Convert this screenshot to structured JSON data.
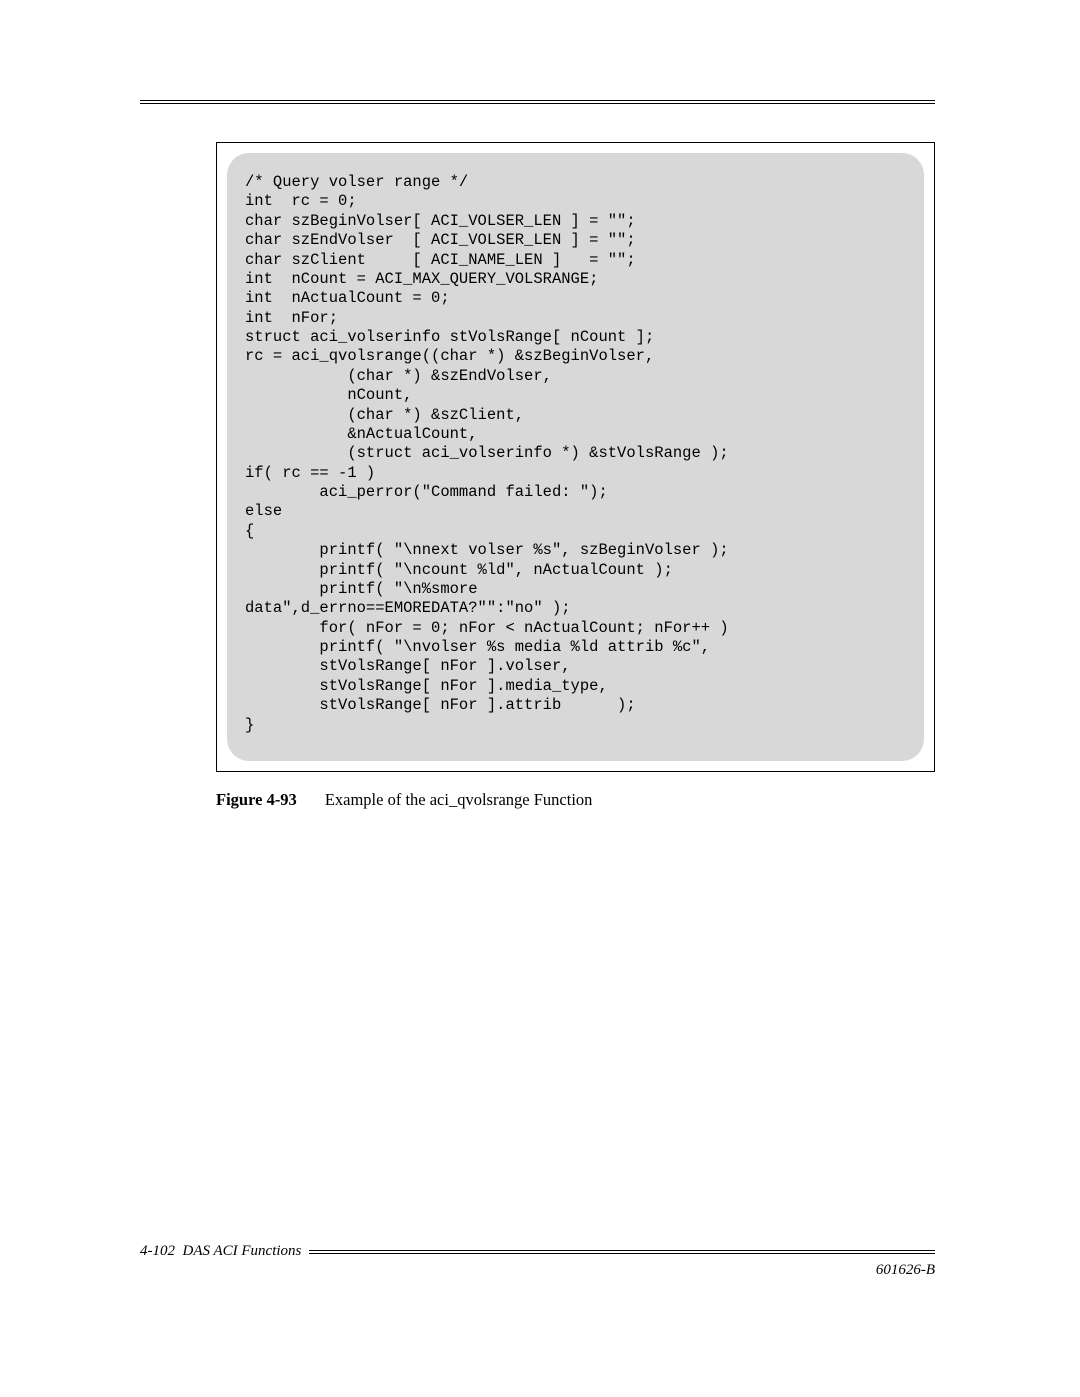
{
  "code": {
    "lines": [
      "/* Query volser range */",
      "int  rc = 0;",
      "char szBeginVolser[ ACI_VOLSER_LEN ] = \"\";",
      "char szEndVolser  [ ACI_VOLSER_LEN ] = \"\";",
      "char szClient     [ ACI_NAME_LEN ]   = \"\";",
      "int  nCount = ACI_MAX_QUERY_VOLSRANGE;",
      "int  nActualCount = 0;",
      "int  nFor;",
      "struct aci_volserinfo stVolsRange[ nCount ];",
      "rc = aci_qvolsrange((char *) &szBeginVolser,",
      "           (char *) &szEndVolser,",
      "           nCount,",
      "           (char *) &szClient,",
      "           &nActualCount,",
      "           (struct aci_volserinfo *) &stVolsRange );",
      "if( rc == -1 )",
      "        aci_perror(\"Command failed: \");",
      "else",
      "{",
      "        printf( \"\\nnext volser %s\", szBeginVolser );",
      "        printf( \"\\ncount %ld\", nActualCount );",
      "        printf( \"\\n%smore ",
      "data\",d_errno==EMOREDATA?\"\":\"no\" );",
      "        for( nFor = 0; nFor < nActualCount; nFor++ )",
      "        printf( \"\\nvolser %s media %ld attrib %c\",",
      "        stVolsRange[ nFor ].volser,",
      "        stVolsRange[ nFor ].media_type,",
      "        stVolsRange[ nFor ].attrib      );",
      "}"
    ]
  },
  "caption": {
    "label": "Figure 4-93",
    "text": "Example of the aci_qvolsrange Function"
  },
  "footer": {
    "page": "4-102",
    "section": "DAS ACI Functions",
    "docid": "601626-B"
  }
}
